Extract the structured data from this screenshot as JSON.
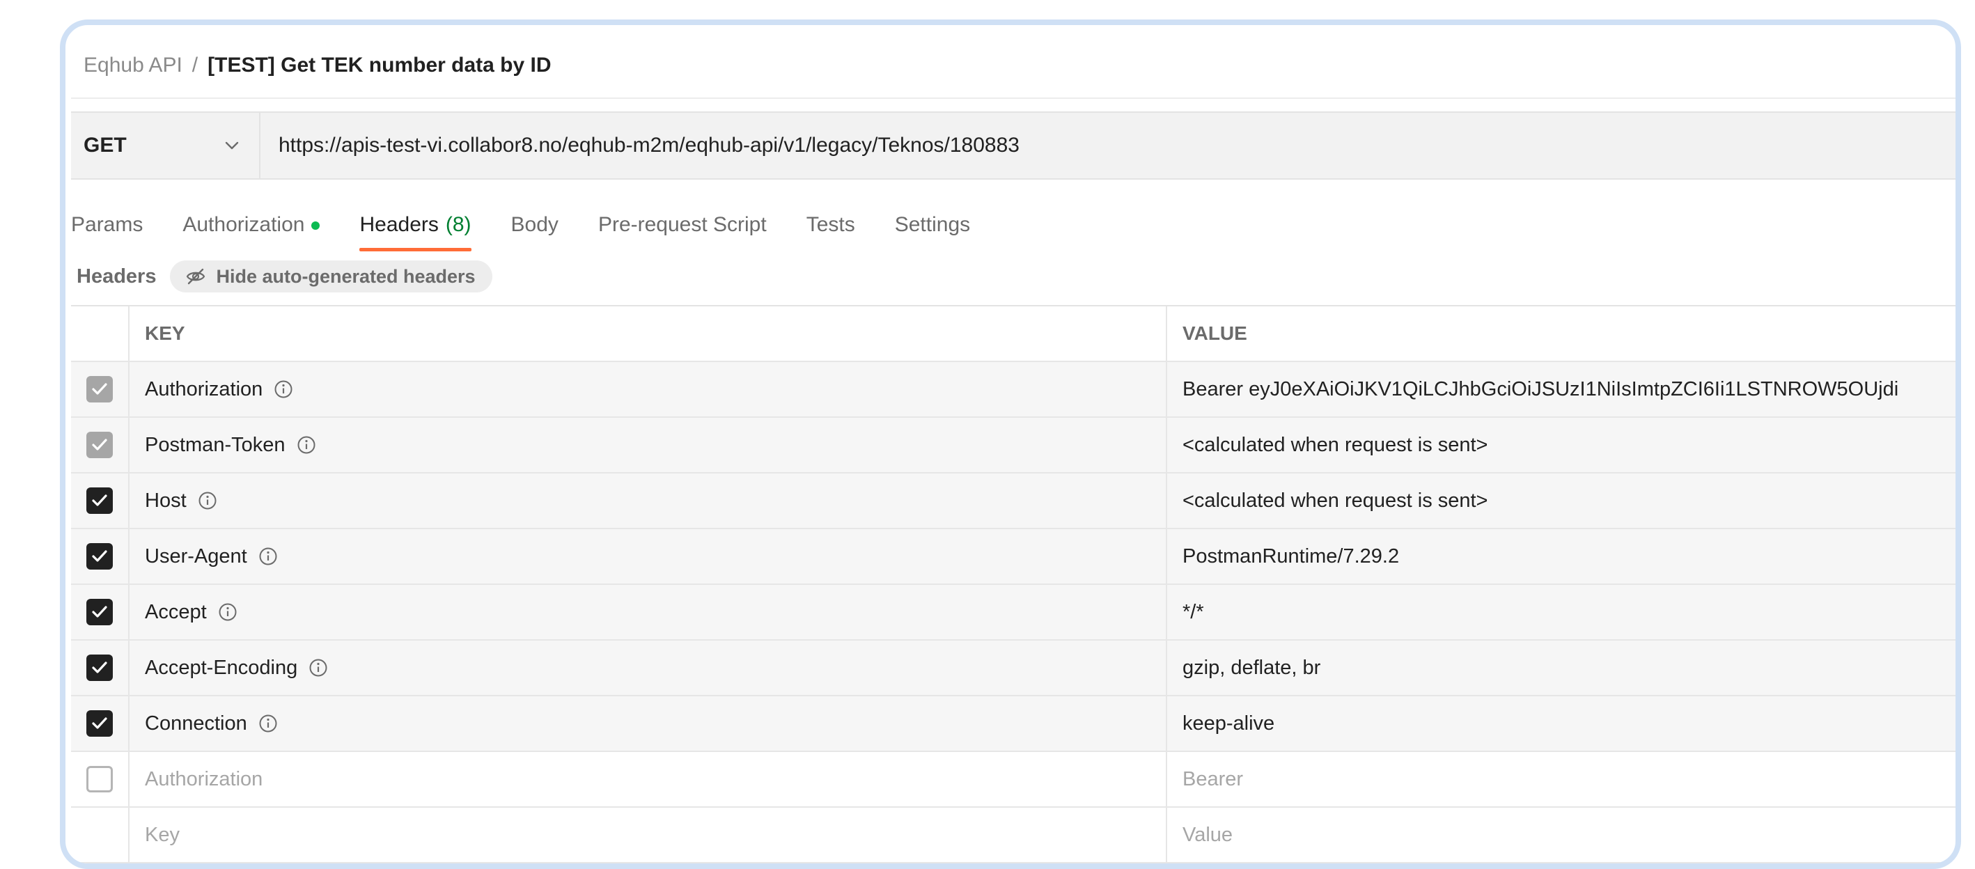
{
  "breadcrumb": {
    "collection": "Eqhub API",
    "separator": "/",
    "request": "[TEST] Get TEK number data by ID"
  },
  "request": {
    "method": "GET",
    "url": "https://apis-test-vi.collabor8.no/eqhub-m2m/eqhub-api/v1/legacy/Teknos/180883"
  },
  "tabs": [
    {
      "label": "Params"
    },
    {
      "label": "Authorization"
    },
    {
      "label": "Headers",
      "count": "(8)",
      "active": true
    },
    {
      "label": "Body"
    },
    {
      "label": "Pre-request Script"
    },
    {
      "label": "Tests"
    },
    {
      "label": "Settings"
    }
  ],
  "headers_section": {
    "title": "Headers",
    "toggle_label": "Hide auto-generated headers"
  },
  "table": {
    "columns": {
      "key": "KEY",
      "value": "VALUE"
    },
    "rows": [
      {
        "key": "Authorization",
        "value": "Bearer eyJ0eXAiOiJKV1QiLCJhbGciOiJSUzI1NiIsImtpZCI6Ii1LSTNROW5OUjdi",
        "checked": "auto"
      },
      {
        "key": "Postman-Token",
        "value": "<calculated when request is sent>",
        "checked": "auto"
      },
      {
        "key": "Host",
        "value": "<calculated when request is sent>",
        "checked": "on"
      },
      {
        "key": "User-Agent",
        "value": "PostmanRuntime/7.29.2",
        "checked": "on"
      },
      {
        "key": "Accept",
        "value": "*/*",
        "checked": "on"
      },
      {
        "key": "Accept-Encoding",
        "value": "gzip, deflate, br",
        "checked": "on"
      },
      {
        "key": "Connection",
        "value": "keep-alive",
        "checked": "on"
      }
    ],
    "disabled_row": {
      "key": "Authorization",
      "value": "Bearer"
    },
    "new_row": {
      "key_placeholder": "Key",
      "value_placeholder": "Value"
    }
  },
  "colors": {
    "active_tab_underline": "#ff6c37",
    "count_green": "#007f31",
    "auth_dot": "#0cbb52",
    "frame_border": "#cfe0f5"
  }
}
